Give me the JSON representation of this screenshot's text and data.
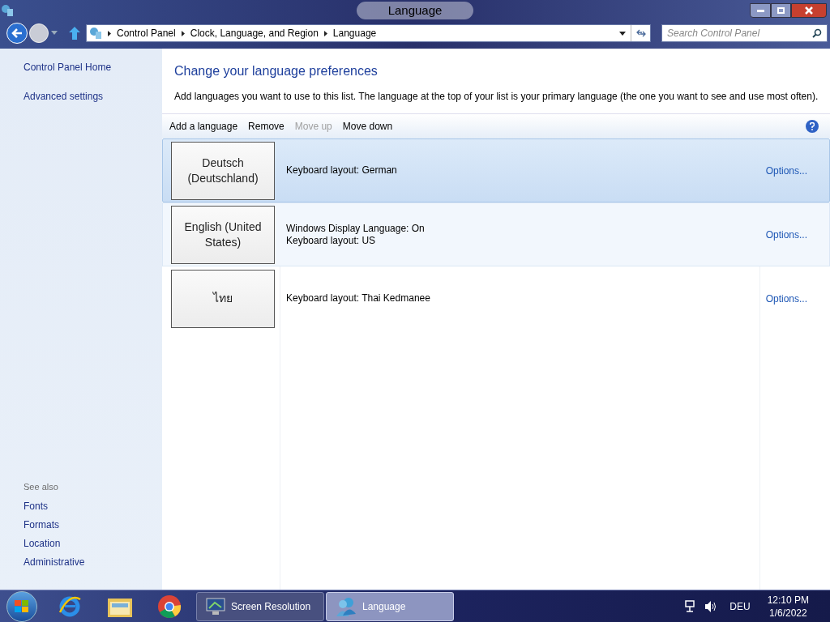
{
  "window": {
    "title": "Language"
  },
  "address_bar": {
    "breadcrumbs": [
      "Control Panel",
      "Clock, Language, and Region",
      "Language"
    ]
  },
  "search": {
    "placeholder": "Search Control Panel"
  },
  "sidebar": {
    "links": [
      "Control Panel Home",
      "Advanced settings"
    ],
    "see_also_heading": "See also",
    "see_also": [
      "Fonts",
      "Formats",
      "Location",
      "Administrative"
    ]
  },
  "main": {
    "heading": "Change your language preferences",
    "description": "Add languages you want to use to this list. The language at the top of your list is your primary language (the one you want to see and use most often).",
    "toolbar": [
      {
        "label": "Add a language",
        "disabled": false
      },
      {
        "label": "Remove",
        "disabled": false
      },
      {
        "label": "Move up",
        "disabled": true
      },
      {
        "label": "Move down",
        "disabled": false
      }
    ],
    "languages": [
      {
        "name": "Deutsch (Deutschland)",
        "details": [
          "Keyboard layout: German"
        ],
        "options": "Options...",
        "selected": true,
        "hovered": false
      },
      {
        "name": "English (United States)",
        "details": [
          "Windows Display Language: On",
          "Keyboard layout: US"
        ],
        "options": "Options...",
        "selected": false,
        "hovered": true
      },
      {
        "name": "ไทย",
        "details": [
          "Keyboard layout: Thai Kedmanee"
        ],
        "options": "Options...",
        "selected": false,
        "hovered": false
      }
    ]
  },
  "taskbar": {
    "buttons": [
      {
        "label": "Screen Resolution",
        "kind": "monitor",
        "selected": false
      },
      {
        "label": "Language",
        "kind": "people",
        "selected": true
      }
    ],
    "language": "DEU",
    "time": "12:10 PM",
    "date": "1/6/2022"
  }
}
